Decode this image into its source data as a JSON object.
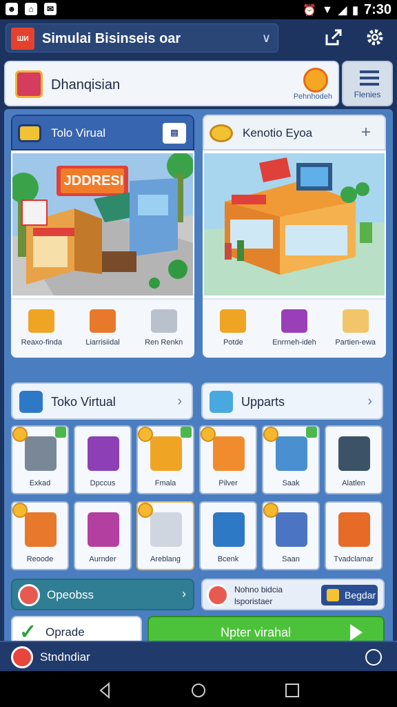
{
  "status": {
    "time": "7:30"
  },
  "topbar": {
    "title": "Simulai Bisinseis oar",
    "logo_text": "ШИ"
  },
  "header": {
    "name": "Dhanqisian",
    "coin_label": "Pehnhodeh",
    "menu_label": "Flenies"
  },
  "panels": [
    {
      "title": "Tolo Virual",
      "scene_sign": "JDDRESI",
      "items": [
        "Reaxo-finda",
        "Liarrisiidal",
        "Ren Renkn"
      ]
    },
    {
      "title": "Kenotio Eyoa",
      "items": [
        "Potde",
        "Enrrneh-ideh",
        "Partien-ewa"
      ]
    }
  ],
  "bars": [
    {
      "title": "Toko Virtual"
    },
    {
      "title": "Upparts"
    }
  ],
  "grid": [
    {
      "label": "Exkad",
      "color": "#7a8797"
    },
    {
      "label": "Dpccus",
      "color": "#8d3fb5"
    },
    {
      "label": "Fmala",
      "color": "#f0a424"
    },
    {
      "label": "Pilver",
      "color": "#f08c2e"
    },
    {
      "label": "Saak",
      "color": "#4a8fd0"
    },
    {
      "label": "Alatlen",
      "color": "#3c5266"
    },
    {
      "label": "Reoode",
      "color": "#e8782c"
    },
    {
      "label": "Aurnder",
      "color": "#b33fa0"
    },
    {
      "label": "Areblang",
      "color": "#cfd6df"
    },
    {
      "label": "Bcenk",
      "color": "#2d79c6"
    },
    {
      "label": "Saan",
      "color": "#4b75c2"
    },
    {
      "label": "Tvadclamar",
      "color": "#e86a27"
    }
  ],
  "bottom": {
    "left": "Opeobss",
    "right_text": "Nohno bidcia lsporistaer",
    "right_button": "Begdar"
  },
  "actions": {
    "left": "Oprade",
    "right": "Npter virahal"
  },
  "footer": {
    "label": "Stndndiar"
  }
}
